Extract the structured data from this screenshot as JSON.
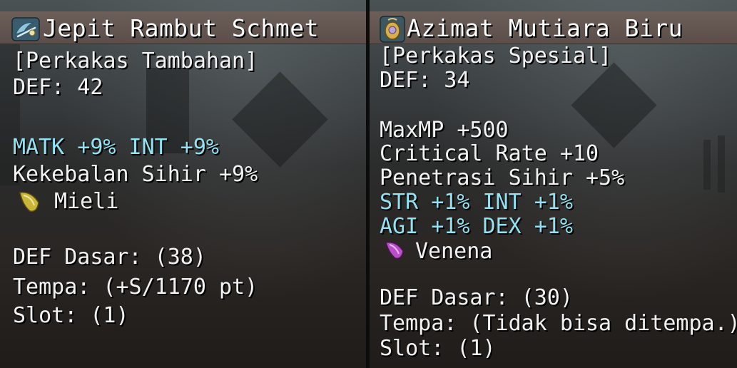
{
  "left_item": {
    "name": "Jepit Rambut Schmet",
    "category": "[Perkakas Tambahan]",
    "def": "DEF: 42",
    "stats_cyan": [
      "MATK +9% INT +9%"
    ],
    "stats_white": [
      "Kekebalan Sihir +9%"
    ],
    "gem_name": "Mieli",
    "gem_color": "#c9b63a",
    "icon": "blue-hairpin-icon",
    "base_def": "DEF Dasar: (38)",
    "refine": "Tempa: (+S/1170 pt)",
    "slot": "Slot: (1)"
  },
  "right_item": {
    "name": "Azimat Mutiara Biru",
    "category": "[Perkakas Spesial]",
    "def": "DEF: 34",
    "stats_white": [
      "MaxMP +500",
      "Critical Rate +10",
      "Penetrasi Sihir +5%"
    ],
    "stats_cyan": [
      "STR +1% INT +1%",
      "AGI +1% DEX +1%"
    ],
    "gem_name": "Venena",
    "gem_color": "#b84fc8",
    "icon": "pearl-amulet-icon",
    "base_def": "DEF Dasar: (30)",
    "refine": "Tempa: (Tidak bisa ditempa.)",
    "slot": "Slot: (1)"
  },
  "colors": {
    "title_bar": "#5f524d",
    "bonus_text": "#8fe3f2",
    "normal_text": "#f2f2f2"
  }
}
